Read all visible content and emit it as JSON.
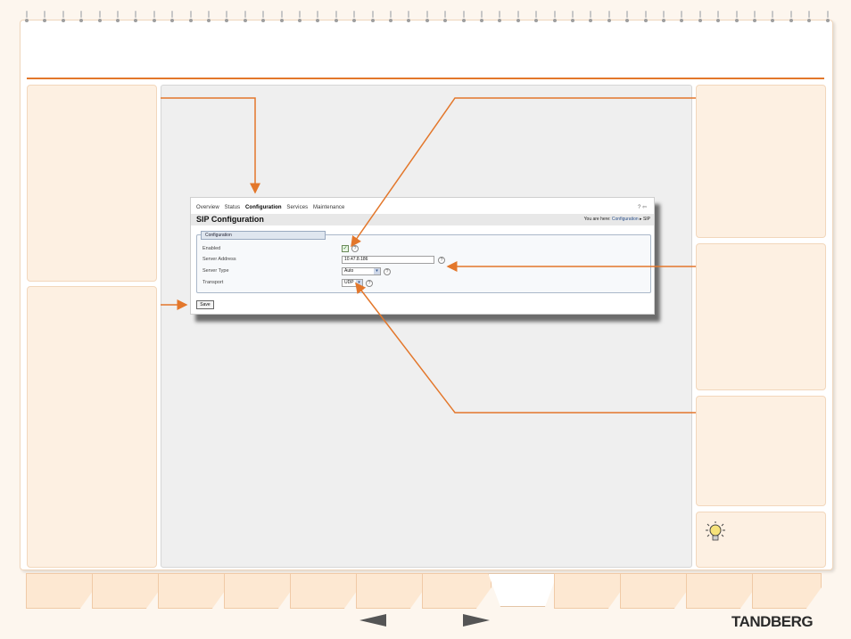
{
  "nav": {
    "items": [
      "Overview",
      "Status",
      "Configuration",
      "Services",
      "Maintenance"
    ],
    "active": "Configuration",
    "help_icon": "?",
    "logout_icon": "⇦"
  },
  "page": {
    "title": "SIP Configuration",
    "breadcrumb_prefix": "You are here:",
    "breadcrumb_link": "Configuration",
    "breadcrumb_sep": "▸",
    "breadcrumb_current": "SIP"
  },
  "form": {
    "section_title": "Configuration",
    "enabled_label": "Enabled",
    "enabled_checked": true,
    "server_address_label": "Server Address",
    "server_address_value": "10.47.8.186",
    "server_type_label": "Server Type",
    "server_type_value": "Auto",
    "transport_label": "Transport",
    "transport_value": "UDP",
    "help_glyph": "?",
    "save_label": "Save"
  },
  "footer": {
    "brand": "TANDBERG"
  },
  "colors": {
    "accent": "#e3772b",
    "panel": "#fdf0e2"
  }
}
